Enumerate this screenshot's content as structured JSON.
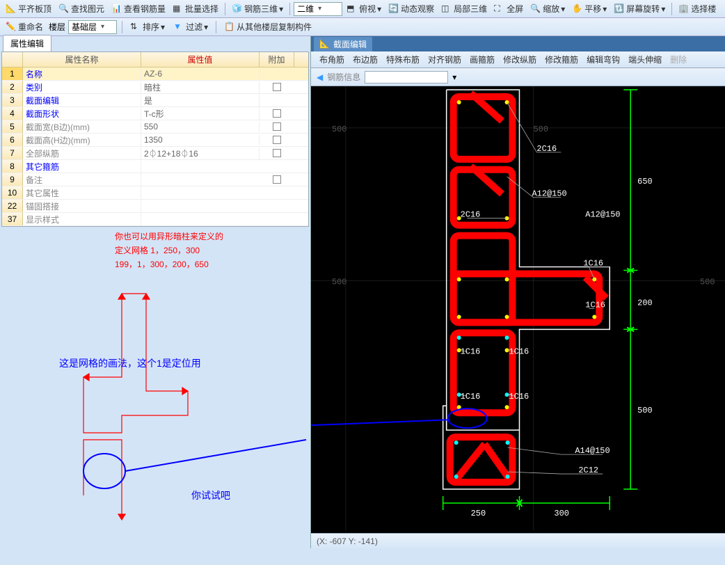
{
  "toolbar1": {
    "pingqi": "平齐板顶",
    "chazhao": "查找图元",
    "chakan": "查看钢筋量",
    "piliang": "批量选择",
    "gangjin3d": "钢筋三维",
    "erw": "二维",
    "fushi": "俯视",
    "dongtai": "动态观察",
    "jubu3d": "局部三维",
    "quanping": "全屏",
    "suofang": "缩放",
    "pingyi": "平移",
    "pingmu": "屏幕旋转",
    "xuanzelou": "选择楼"
  },
  "toolbar2": {
    "chongming": "重命名",
    "louceng": "楼层",
    "jichu": "基础层",
    "paixu": "排序",
    "guolv": "过滤",
    "congqita": "从其他楼层复制构件"
  },
  "propsTab": "属性编辑",
  "grid": {
    "h_name": "属性名称",
    "h_value": "属性值",
    "h_extra": "附加",
    "rows": [
      {
        "n": "1",
        "name": "名称",
        "val": "AZ-6",
        "chk": false,
        "blue": true,
        "sel": true
      },
      {
        "n": "2",
        "name": "类别",
        "val": "暗柱",
        "chk": true,
        "blue": true
      },
      {
        "n": "3",
        "name": "截面编辑",
        "val": "是",
        "chk": false,
        "blue": true
      },
      {
        "n": "4",
        "name": "截面形状",
        "val": "T-c形",
        "chk": true,
        "blue": true
      },
      {
        "n": "5",
        "name": "截面宽(B边)(mm)",
        "val": "550",
        "chk": true,
        "gray": true
      },
      {
        "n": "6",
        "name": "截面高(H边)(mm)",
        "val": "1350",
        "chk": true,
        "gray": true
      },
      {
        "n": "7",
        "name": "全部纵筋",
        "val": "2⏀12+18⏀16",
        "chk": true,
        "gray": true
      },
      {
        "n": "8",
        "name": "其它箍筋",
        "val": "",
        "chk": false,
        "blue": true
      },
      {
        "n": "9",
        "name": "备注",
        "val": "",
        "chk": true,
        "gray": true
      },
      {
        "n": "10",
        "name": "其它属性",
        "val": "",
        "exp": true,
        "gray": true
      },
      {
        "n": "22",
        "name": "锚固搭接",
        "val": "",
        "exp": true,
        "gray": true
      },
      {
        "n": "37",
        "name": "显示样式",
        "val": "",
        "exp": true,
        "gray": true
      }
    ]
  },
  "annot": {
    "l1": "你也可以用异形暗柱来定义的",
    "l2": "定义网格   1，250，300",
    "l3": "199，1，300，200，650",
    "mid": "这是网格的画法，这个1是定位用",
    "try": "你试试吧"
  },
  "rightTab": "截面编辑",
  "rightToolbar": [
    "布角筋",
    "布边筋",
    "特殊布筋",
    "对齐钢筋",
    "画箍筋",
    "修改纵筋",
    "修改箍筋",
    "编辑弯钩",
    "端头伸缩",
    "删除"
  ],
  "rightSub": {
    "label": "钢筋信息"
  },
  "status": "(X: -607 Y: -141)",
  "cad": {
    "dims_v": [
      "650",
      "200",
      "500"
    ],
    "dims_h": [
      "250",
      "300"
    ],
    "labels": [
      "2C16",
      "A12@150",
      "2C16",
      "A12@150",
      "1C16",
      "1C16",
      "1C16",
      "1C16",
      "1C16",
      "1C16",
      "A14@150",
      "2C12"
    ],
    "grid500": "500"
  }
}
